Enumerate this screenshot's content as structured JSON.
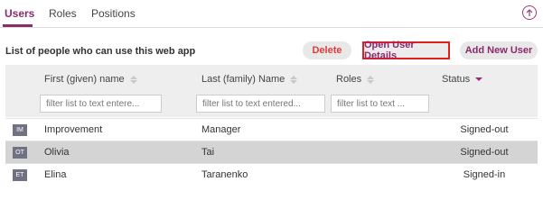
{
  "tabs": [
    "Users",
    "Roles",
    "Positions"
  ],
  "caption": "List of people who can use this web app",
  "buttons": {
    "delete": "Delete",
    "open_details": "Open User Details",
    "add_user": "Add New User"
  },
  "columns": [
    "First (given) name",
    "Last (family) Name",
    "Roles",
    "Status"
  ],
  "filters": [
    "filter list to text entere...",
    "filter list to text entered...",
    "filter list to text ...",
    ""
  ],
  "rows": [
    {
      "initials": "IM",
      "first": "Improvement",
      "last": "Manager",
      "roles": "",
      "status": "Signed-out",
      "selected": false
    },
    {
      "initials": "OT",
      "first": "Olivia",
      "last": "Tai",
      "roles": "",
      "status": "Signed-out",
      "selected": true
    },
    {
      "initials": "ET",
      "first": "Elina",
      "last": "Taranenko",
      "roles": "",
      "status": "Signed-in",
      "selected": false
    }
  ],
  "colors": {
    "accent": "#8b2a6c",
    "delete": "#e03a3a",
    "highlight_border": "#e02020",
    "avatar_bg": "#6e7282"
  },
  "icons": {
    "top_right": "upload-arrow-icon"
  }
}
